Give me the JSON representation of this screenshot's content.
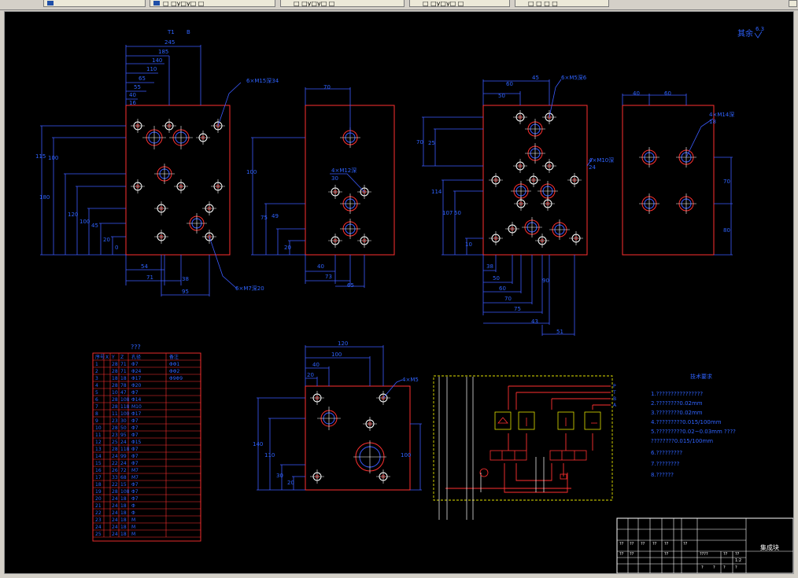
{
  "tabs": [
    {
      "label": ""
    },
    {
      "label": "□ □y□y□ □"
    },
    {
      "label": "□ □y□y□ □"
    },
    {
      "label": "□ □y□y□ □"
    },
    {
      "label": "□ □ □ □"
    }
  ],
  "drawing": {
    "surface_finish": {
      "label": "其余",
      "value": "6.3"
    },
    "view1": {
      "dims_top": [
        "245",
        "185",
        "140",
        "110",
        "65",
        "55",
        "40",
        "16"
      ],
      "dims_left": [
        "115",
        "100",
        "180",
        "120",
        "100",
        "45",
        "20",
        "0"
      ],
      "dims_bottom": [
        "54",
        "71",
        "38",
        "95"
      ],
      "leader_top": "6×M15深34",
      "leader_bottom": "6×M7深20",
      "col_labels": [
        "B",
        "T1"
      ]
    },
    "view2": {
      "dims_top": [
        "70"
      ],
      "dims_left": [
        "100",
        "75",
        "49",
        "20"
      ],
      "dims_bottom": [
        "40",
        "73",
        "65"
      ],
      "leader": "4×M12深",
      "leader_sub": "30"
    },
    "view3": {
      "dims_top": [
        "60",
        "45",
        "50"
      ],
      "dims_left": [
        "70",
        "25",
        "114",
        "107",
        "50",
        "10"
      ],
      "dims_bottom": [
        "38",
        "50",
        "60",
        "70",
        "75",
        "90",
        "43",
        "51"
      ],
      "leader_top": "6×M5深6",
      "leader_right": "4×M10深",
      "leader_right_sub": "24"
    },
    "view4": {
      "dims_top": [
        "40",
        "60"
      ],
      "dims_right": [
        "70",
        "80"
      ],
      "leader": "4×M14深",
      "leader_sub": "18"
    },
    "view5": {
      "dims_top": [
        "120",
        "100",
        "40",
        "20"
      ],
      "dims_left": [
        "140",
        "110",
        "30",
        "20"
      ],
      "dims_right": [
        "100"
      ],
      "leader": "4×M5"
    },
    "bom": {
      "title": "???",
      "headers": [
        "序号",
        "X",
        "Y",
        "Z",
        "孔径",
        "备注"
      ],
      "rows": [
        [
          "1",
          "",
          "28",
          "71",
          "Φ7",
          "ΦΦ1"
        ],
        [
          "2",
          "",
          "28",
          "71",
          "Φ24",
          "ΦΦ2"
        ],
        [
          "3",
          "",
          "18",
          "18",
          "Φ17",
          "Φ9Φ9"
        ],
        [
          "4",
          "",
          "28",
          "78",
          "Φ20",
          ""
        ],
        [
          "5",
          "",
          "10",
          "47",
          "Φ7",
          ""
        ],
        [
          "6",
          "",
          "28",
          "108",
          "Φ14",
          ""
        ],
        [
          "7",
          "",
          "28",
          "118",
          "M10",
          ""
        ],
        [
          "8",
          "",
          "11",
          "100",
          "Φ17",
          ""
        ],
        [
          "9",
          "",
          "23",
          "30",
          "Φ7",
          ""
        ],
        [
          "10",
          "",
          "28",
          "50",
          "Φ7",
          ""
        ],
        [
          "11",
          "",
          "23",
          "95",
          "Φ7",
          ""
        ],
        [
          "12",
          "",
          "25",
          "24",
          "Φ15",
          ""
        ],
        [
          "13",
          "",
          "28",
          "118",
          "Φ7",
          ""
        ],
        [
          "14",
          "",
          "24",
          "99",
          "Φ7",
          ""
        ],
        [
          "15",
          "",
          "22",
          "24",
          "Φ7",
          ""
        ],
        [
          "16",
          "",
          "26",
          "72",
          "M7",
          ""
        ],
        [
          "17",
          "",
          "33",
          "68",
          "M7",
          ""
        ],
        [
          "18",
          "",
          "22",
          "15",
          "Φ7",
          ""
        ],
        [
          "19",
          "",
          "28",
          "108",
          "Φ7",
          ""
        ],
        [
          "20",
          "",
          "24",
          "18",
          "Φ7",
          ""
        ],
        [
          "21",
          "",
          "24",
          "18",
          "Φ",
          ""
        ],
        [
          "22",
          "",
          "24",
          "18",
          "Φ",
          ""
        ],
        [
          "23",
          "",
          "24",
          "18",
          "M",
          ""
        ],
        [
          "24",
          "",
          "24",
          "18",
          "M",
          ""
        ],
        [
          "25",
          "",
          "24",
          "18",
          "M",
          ""
        ]
      ]
    },
    "notes": {
      "title": "技术要求",
      "items": [
        "1.????????????????",
        "2.????????0.02mm",
        "3.????????0.02mm",
        "4.?????????0.015/100mm",
        "5.?????????0.02~0.03mm ????",
        "  ????????0.015/100mm",
        "6.?????????",
        "7.????????",
        "8.??????"
      ]
    },
    "schematic": {
      "ports": [
        "P",
        "T",
        "B",
        "A"
      ]
    },
    "title_block": {
      "drawing_title": "集成块",
      "scale": "1:2",
      "cells": [
        "??",
        "??",
        "??",
        "??",
        "??",
        "??",
        "????",
        "??",
        "??",
        "??",
        "??",
        "??",
        "?",
        "?",
        "?",
        "?"
      ]
    }
  }
}
